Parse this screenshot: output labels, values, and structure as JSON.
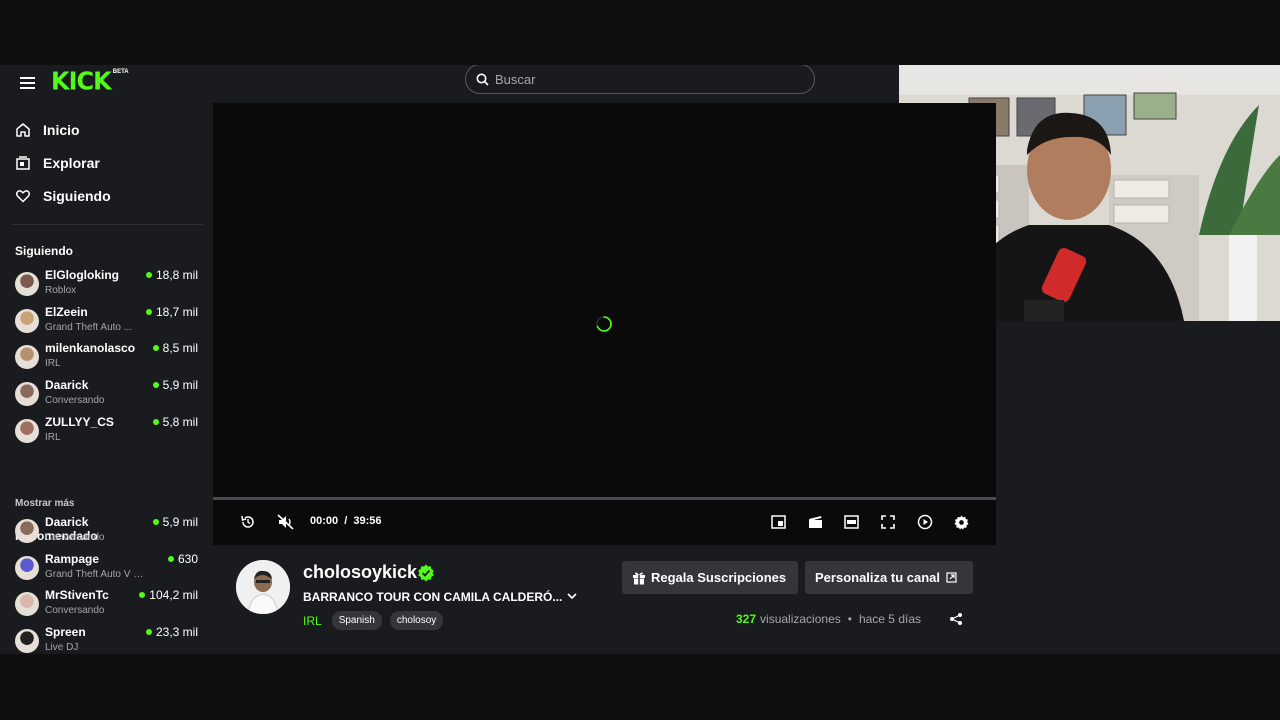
{
  "header": {
    "logo_text": "KICK",
    "logo_badge": "BETA",
    "search_placeholder": "Buscar"
  },
  "nav": [
    {
      "label": "Inicio",
      "icon": "home-icon"
    },
    {
      "label": "Explorar",
      "icon": "browse-icon"
    },
    {
      "label": "Siguiendo",
      "icon": "heart-icon"
    }
  ],
  "following": {
    "title": "Siguiendo",
    "channels": [
      {
        "name": "ElGlogloking",
        "category": "Roblox",
        "viewers": "18,8 mil",
        "avatar_color": "#7a5a4a"
      },
      {
        "name": "ElZeein",
        "category": "Grand Theft Auto ...",
        "viewers": "18,7 mil",
        "avatar_color": "#c9a27a"
      },
      {
        "name": "milenkanolasco",
        "category": "IRL",
        "viewers": "8,5 mil",
        "avatar_color": "#b89070"
      },
      {
        "name": "Daarick",
        "category": "Conversando",
        "viewers": "5,9 mil",
        "avatar_color": "#8a6a5a"
      },
      {
        "name": "ZULLYY_CS",
        "category": "IRL",
        "viewers": "5,8 mil",
        "avatar_color": "#a07060"
      }
    ],
    "show_more": "Mostrar más"
  },
  "recommended": {
    "title": "Recomendado",
    "channels": [
      {
        "name": "Daarick",
        "category": "Conversando",
        "viewers": "5,9 mil",
        "avatar_color": "#8a6a5a"
      },
      {
        "name": "Rampage",
        "category": "Grand Theft Auto V (G...",
        "viewers": "630",
        "avatar_color": "#5a5ad0"
      },
      {
        "name": "MrStivenTc",
        "category": "Conversando",
        "viewers": "104,2 mil",
        "avatar_color": "#d8b8a8"
      },
      {
        "name": "Spreen",
        "category": "Live DJ",
        "viewers": "23,3 mil",
        "avatar_color": "#222222"
      }
    ]
  },
  "player": {
    "current_time": "00:00",
    "duration": "39:56",
    "time_separator": "/",
    "progress": 0
  },
  "stream": {
    "channel_name": "cholosoykick",
    "title": "BARRANCO TOUR CON CAMILA CALDERÓ...",
    "category": "IRL",
    "tags": [
      "Spanish",
      "cholosoy"
    ],
    "gift_button": "Regala Suscripciones",
    "customize_button": "Personaliza tu canal",
    "views_count": "327",
    "views_label": "visualizaciones",
    "separator": "•",
    "time_ago": "hace 5 días"
  },
  "colors": {
    "accent": "#53fc18",
    "background": "#191b1f",
    "player_bg": "#0a0a0b",
    "button_bg": "#34363b"
  }
}
